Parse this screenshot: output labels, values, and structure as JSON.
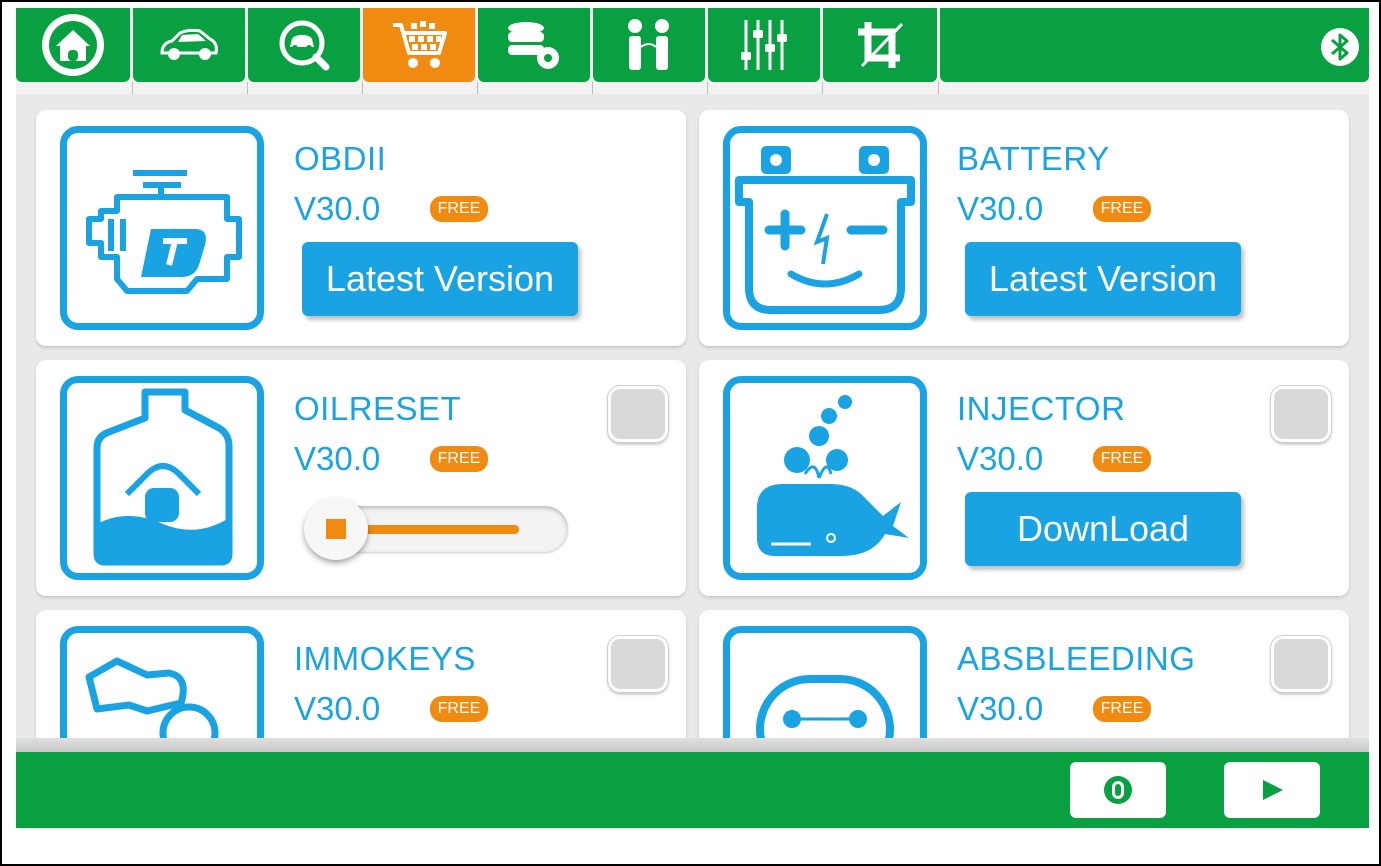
{
  "colors": {
    "brand_green": "#08a040",
    "accent_orange": "#f08a10",
    "accent_blue": "#1aa3e3"
  },
  "nav": {
    "tabs": [
      {
        "icon": "home-icon"
      },
      {
        "icon": "car-icon"
      },
      {
        "icon": "car-search-icon"
      },
      {
        "icon": "shopping-cart-icon",
        "active": true
      },
      {
        "icon": "database-settings-icon"
      },
      {
        "icon": "people-icon"
      },
      {
        "icon": "sliders-icon"
      },
      {
        "icon": "crop-icon"
      }
    ],
    "status_icon": "bluetooth-icon"
  },
  "apps": [
    {
      "name": "OBDII",
      "version": "V30.0",
      "badge": "FREE",
      "icon": "engine-icon",
      "action": "Latest Version"
    },
    {
      "name": "BATTERY",
      "version": "V30.0",
      "badge": "FREE",
      "icon": "battery-icon",
      "action": "Latest Version"
    },
    {
      "name": "OILRESET",
      "version": "V30.0",
      "badge": "FREE",
      "icon": "oil-can-icon",
      "checkbox": false,
      "progress": 0.05
    },
    {
      "name": "INJECTOR",
      "version": "V30.0",
      "badge": "FREE",
      "icon": "whale-oil-icon",
      "checkbox": false,
      "action": "DownLoad"
    },
    {
      "name": "IMMOKEYS",
      "version": "V30.0",
      "badge": "FREE",
      "icon": "keys-icon",
      "checkbox": false
    },
    {
      "name": "ABSBLEEDING",
      "version": "V30.0",
      "badge": "FREE",
      "icon": "abs-icon",
      "checkbox": false
    }
  ],
  "bottom": {
    "buttons": [
      {
        "icon": "select-all-icon"
      },
      {
        "icon": "play-icon"
      }
    ]
  }
}
